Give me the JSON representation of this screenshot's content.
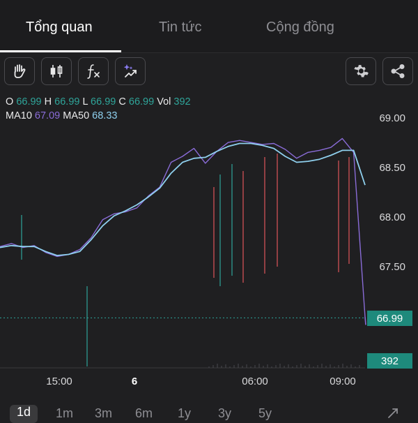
{
  "tabs": [
    {
      "label": "Tổng quan",
      "active": true
    },
    {
      "label": "Tin tức",
      "active": false
    },
    {
      "label": "Cộng đồng",
      "active": false
    }
  ],
  "toolbar": {
    "left_icons": [
      "hand-icon",
      "candlestick-icon",
      "function-icon",
      "sparkle-chart-icon"
    ],
    "right_icons": [
      "gear-icon",
      "share-icon"
    ]
  },
  "ohlc": {
    "o_label": "O",
    "o": "66.99",
    "h_label": "H",
    "h": "66.99",
    "l_label": "L",
    "l": "66.99",
    "c_label": "C",
    "c": "66.99",
    "vol_label": "Vol",
    "vol": "392"
  },
  "ma": {
    "ma10_label": "MA10",
    "ma10": "67.09",
    "ma50_label": "MA50",
    "ma50": "68.33"
  },
  "colors": {
    "up": "#2fa59a",
    "down": "#e0555a",
    "ma10": "#8a6cd8",
    "ma50": "#8fd0ee",
    "background": "#1f1f21"
  },
  "chart_data": {
    "type": "line",
    "yticks": [
      "69.00",
      "68.50",
      "68.00",
      "67.50"
    ],
    "ylim": [
      66.8,
      69.1
    ],
    "xticks": [
      "15:00",
      "6",
      "06:00",
      "09:00"
    ],
    "current_price": "66.99",
    "current_volume": "392",
    "series": [
      {
        "name": "MA10",
        "values": [
          67.71,
          67.74,
          67.7,
          67.72,
          67.65,
          67.61,
          67.63,
          67.68,
          67.8,
          67.98,
          68.04,
          68.06,
          68.1,
          68.22,
          68.31,
          68.56,
          68.62,
          68.7,
          68.55,
          68.67,
          68.76,
          68.78,
          68.76,
          68.74,
          68.75,
          68.69,
          68.6,
          68.66,
          68.68,
          68.71,
          68.8,
          68.66,
          67.0
        ]
      },
      {
        "name": "MA50",
        "values": [
          67.7,
          67.72,
          67.71,
          67.71,
          67.66,
          67.62,
          67.63,
          67.66,
          67.78,
          67.92,
          68.02,
          68.07,
          68.13,
          68.21,
          68.3,
          68.45,
          68.56,
          68.6,
          68.61,
          68.67,
          68.72,
          68.75,
          68.75,
          68.73,
          68.7,
          68.62,
          68.56,
          68.57,
          68.59,
          68.63,
          68.68,
          68.68,
          68.33
        ]
      }
    ]
  },
  "time_ranges": [
    {
      "label": "1d",
      "active": true
    },
    {
      "label": "1m",
      "active": false
    },
    {
      "label": "3m",
      "active": false
    },
    {
      "label": "6m",
      "active": false
    },
    {
      "label": "1y",
      "active": false
    },
    {
      "label": "3y",
      "active": false
    },
    {
      "label": "5y",
      "active": false
    }
  ],
  "expand_icon": "expand-icon"
}
